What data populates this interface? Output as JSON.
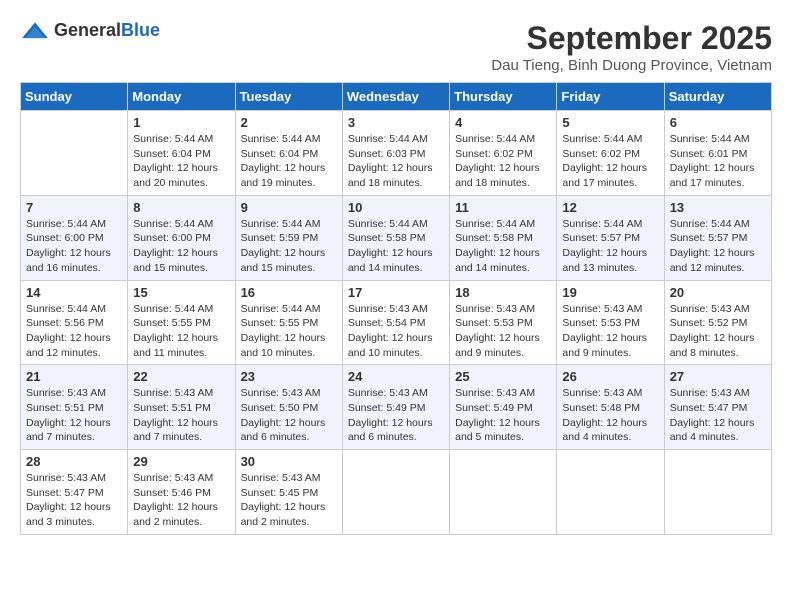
{
  "header": {
    "logo_general": "General",
    "logo_blue": "Blue",
    "month": "September 2025",
    "location": "Dau Tieng, Binh Duong Province, Vietnam"
  },
  "columns": [
    "Sunday",
    "Monday",
    "Tuesday",
    "Wednesday",
    "Thursday",
    "Friday",
    "Saturday"
  ],
  "weeks": [
    [
      {
        "day": "",
        "info": ""
      },
      {
        "day": "1",
        "info": "Sunrise: 5:44 AM\nSunset: 6:04 PM\nDaylight: 12 hours\nand 20 minutes."
      },
      {
        "day": "2",
        "info": "Sunrise: 5:44 AM\nSunset: 6:04 PM\nDaylight: 12 hours\nand 19 minutes."
      },
      {
        "day": "3",
        "info": "Sunrise: 5:44 AM\nSunset: 6:03 PM\nDaylight: 12 hours\nand 18 minutes."
      },
      {
        "day": "4",
        "info": "Sunrise: 5:44 AM\nSunset: 6:02 PM\nDaylight: 12 hours\nand 18 minutes."
      },
      {
        "day": "5",
        "info": "Sunrise: 5:44 AM\nSunset: 6:02 PM\nDaylight: 12 hours\nand 17 minutes."
      },
      {
        "day": "6",
        "info": "Sunrise: 5:44 AM\nSunset: 6:01 PM\nDaylight: 12 hours\nand 17 minutes."
      }
    ],
    [
      {
        "day": "7",
        "info": "Sunrise: 5:44 AM\nSunset: 6:00 PM\nDaylight: 12 hours\nand 16 minutes."
      },
      {
        "day": "8",
        "info": "Sunrise: 5:44 AM\nSunset: 6:00 PM\nDaylight: 12 hours\nand 15 minutes."
      },
      {
        "day": "9",
        "info": "Sunrise: 5:44 AM\nSunset: 5:59 PM\nDaylight: 12 hours\nand 15 minutes."
      },
      {
        "day": "10",
        "info": "Sunrise: 5:44 AM\nSunset: 5:58 PM\nDaylight: 12 hours\nand 14 minutes."
      },
      {
        "day": "11",
        "info": "Sunrise: 5:44 AM\nSunset: 5:58 PM\nDaylight: 12 hours\nand 14 minutes."
      },
      {
        "day": "12",
        "info": "Sunrise: 5:44 AM\nSunset: 5:57 PM\nDaylight: 12 hours\nand 13 minutes."
      },
      {
        "day": "13",
        "info": "Sunrise: 5:44 AM\nSunset: 5:57 PM\nDaylight: 12 hours\nand 12 minutes."
      }
    ],
    [
      {
        "day": "14",
        "info": "Sunrise: 5:44 AM\nSunset: 5:56 PM\nDaylight: 12 hours\nand 12 minutes."
      },
      {
        "day": "15",
        "info": "Sunrise: 5:44 AM\nSunset: 5:55 PM\nDaylight: 12 hours\nand 11 minutes."
      },
      {
        "day": "16",
        "info": "Sunrise: 5:44 AM\nSunset: 5:55 PM\nDaylight: 12 hours\nand 10 minutes."
      },
      {
        "day": "17",
        "info": "Sunrise: 5:43 AM\nSunset: 5:54 PM\nDaylight: 12 hours\nand 10 minutes."
      },
      {
        "day": "18",
        "info": "Sunrise: 5:43 AM\nSunset: 5:53 PM\nDaylight: 12 hours\nand 9 minutes."
      },
      {
        "day": "19",
        "info": "Sunrise: 5:43 AM\nSunset: 5:53 PM\nDaylight: 12 hours\nand 9 minutes."
      },
      {
        "day": "20",
        "info": "Sunrise: 5:43 AM\nSunset: 5:52 PM\nDaylight: 12 hours\nand 8 minutes."
      }
    ],
    [
      {
        "day": "21",
        "info": "Sunrise: 5:43 AM\nSunset: 5:51 PM\nDaylight: 12 hours\nand 7 minutes."
      },
      {
        "day": "22",
        "info": "Sunrise: 5:43 AM\nSunset: 5:51 PM\nDaylight: 12 hours\nand 7 minutes."
      },
      {
        "day": "23",
        "info": "Sunrise: 5:43 AM\nSunset: 5:50 PM\nDaylight: 12 hours\nand 6 minutes."
      },
      {
        "day": "24",
        "info": "Sunrise: 5:43 AM\nSunset: 5:49 PM\nDaylight: 12 hours\nand 6 minutes."
      },
      {
        "day": "25",
        "info": "Sunrise: 5:43 AM\nSunset: 5:49 PM\nDaylight: 12 hours\nand 5 minutes."
      },
      {
        "day": "26",
        "info": "Sunrise: 5:43 AM\nSunset: 5:48 PM\nDaylight: 12 hours\nand 4 minutes."
      },
      {
        "day": "27",
        "info": "Sunrise: 5:43 AM\nSunset: 5:47 PM\nDaylight: 12 hours\nand 4 minutes."
      }
    ],
    [
      {
        "day": "28",
        "info": "Sunrise: 5:43 AM\nSunset: 5:47 PM\nDaylight: 12 hours\nand 3 minutes."
      },
      {
        "day": "29",
        "info": "Sunrise: 5:43 AM\nSunset: 5:46 PM\nDaylight: 12 hours\nand 2 minutes."
      },
      {
        "day": "30",
        "info": "Sunrise: 5:43 AM\nSunset: 5:45 PM\nDaylight: 12 hours\nand 2 minutes."
      },
      {
        "day": "",
        "info": ""
      },
      {
        "day": "",
        "info": ""
      },
      {
        "day": "",
        "info": ""
      },
      {
        "day": "",
        "info": ""
      }
    ]
  ]
}
